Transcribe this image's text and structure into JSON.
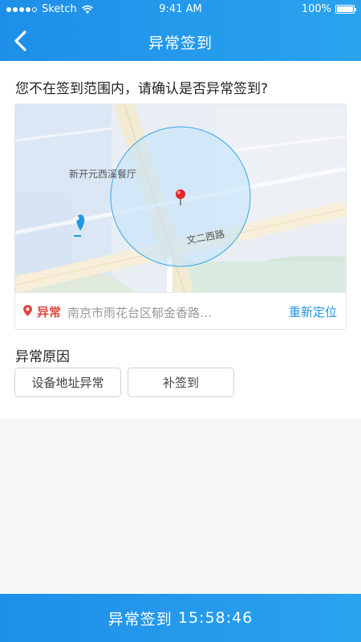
{
  "status_bar": {
    "carrier": "Sketch",
    "time": "9:41 AM",
    "battery": "100%"
  },
  "nav": {
    "title": "异常签到"
  },
  "main": {
    "question": "您不在签到范围内，请确认是否异常签到?",
    "map": {
      "poi_label": "新开元西溪餐厅",
      "road_label": "文二西路"
    },
    "location": {
      "status": "异常",
      "address": "南京市雨花台区郁金香路…",
      "relocate_label": "重新定位"
    },
    "reason": {
      "title": "异常原因",
      "options": [
        "设备地址异常",
        "补签到"
      ]
    }
  },
  "footer": {
    "action_label": "异常签到",
    "time": "15:58:46"
  },
  "colors": {
    "brand_blue": "#1e8fe8",
    "abnormal_red": "#e0463f",
    "link_blue": "#1f94e6"
  }
}
